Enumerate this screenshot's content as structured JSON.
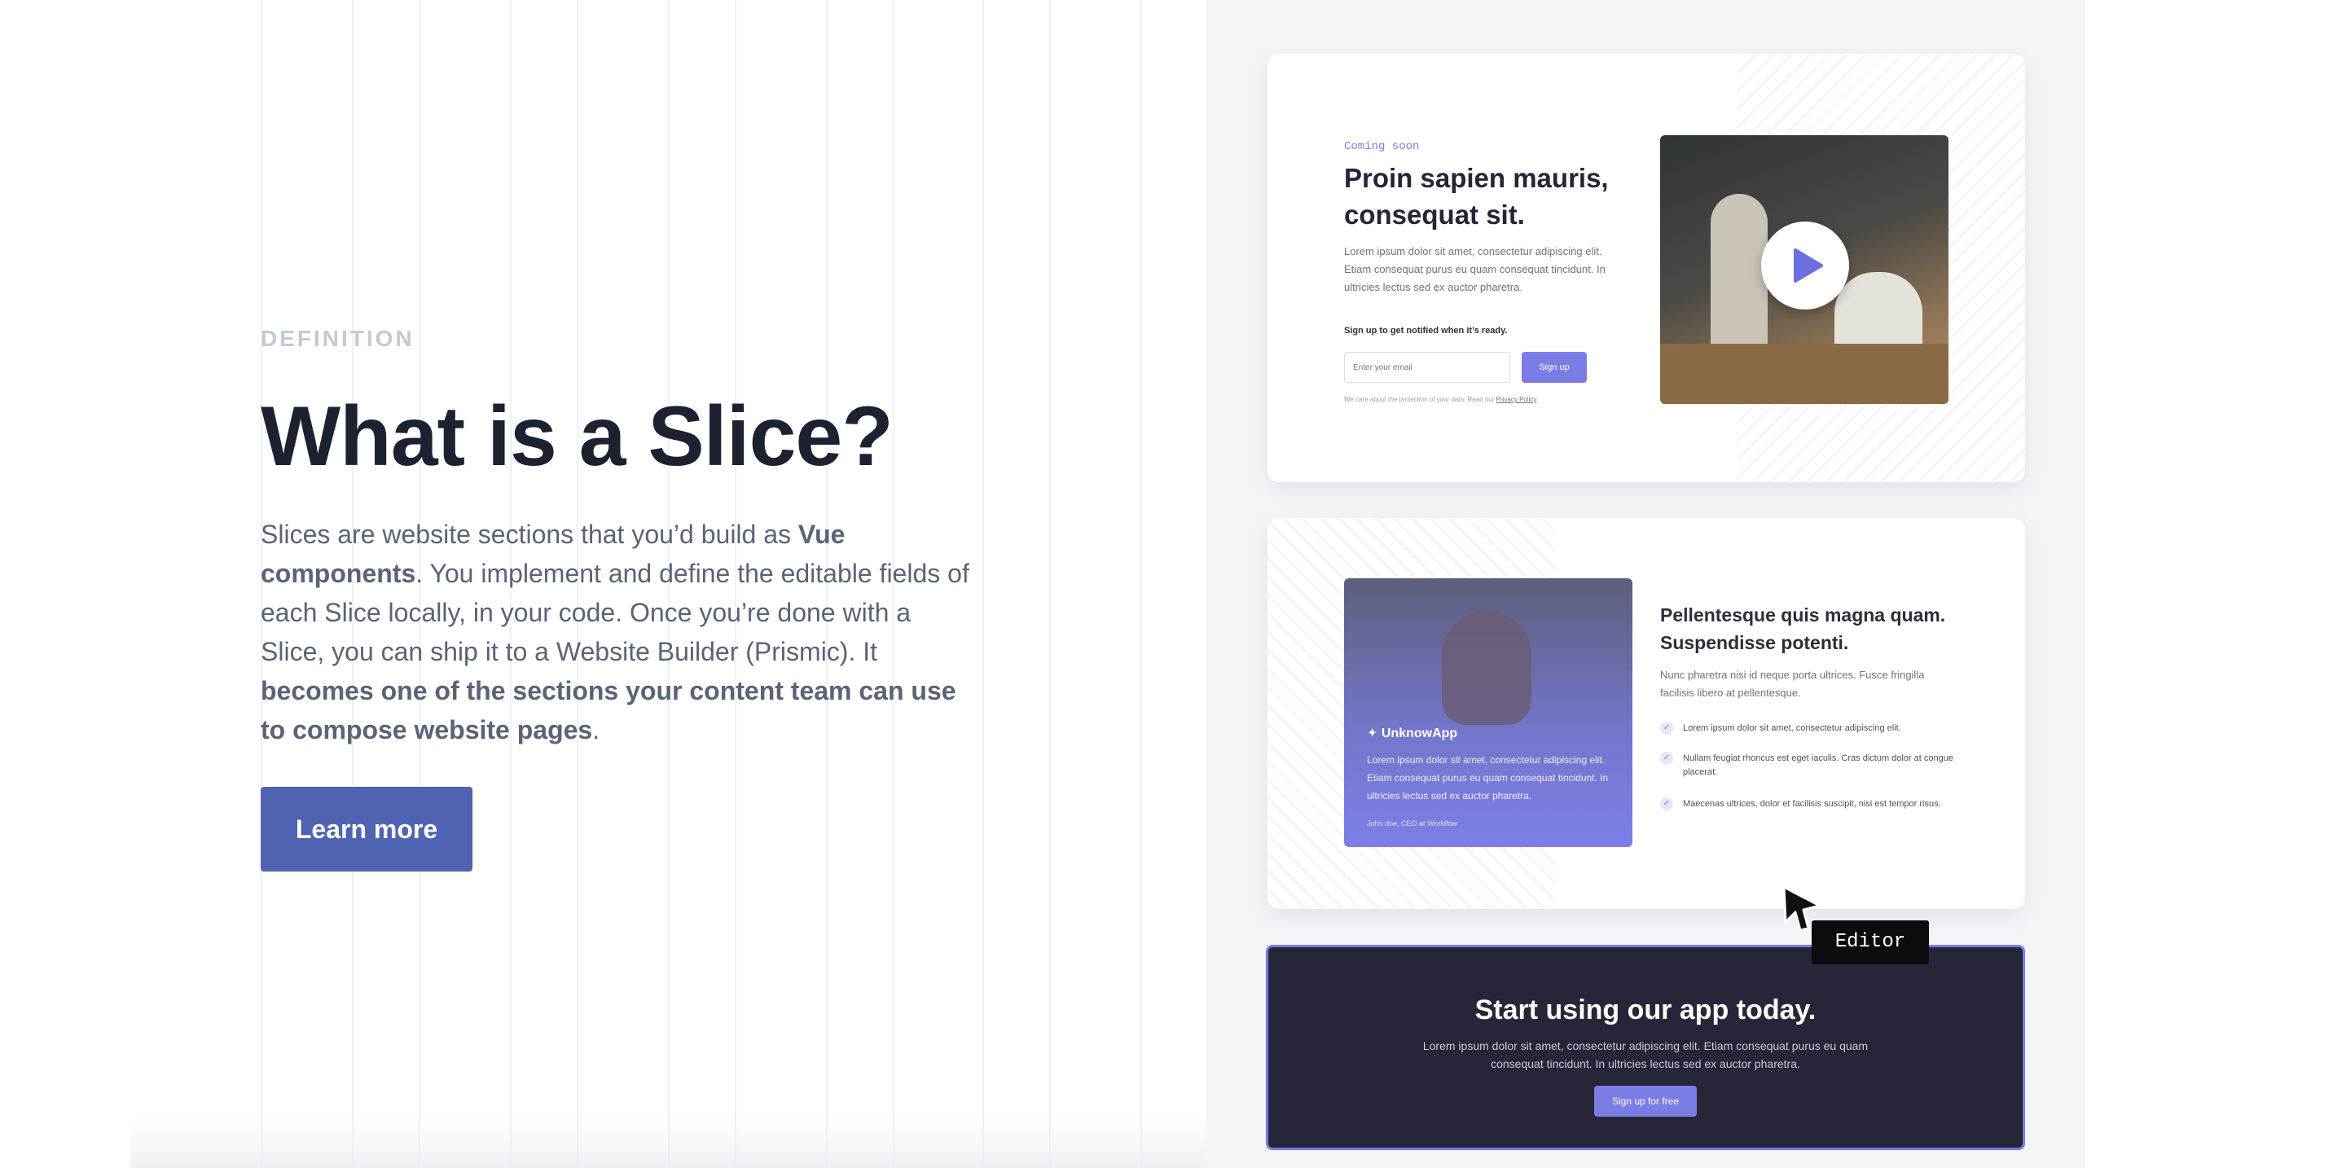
{
  "definition": {
    "eyebrow": "DEFINITION",
    "heading": "What is a Slice?",
    "para": {
      "t1": "Slices are website sections that you’d build as ",
      "b1": "Vue components",
      "t2": ". You implement and define the editable fields of each Slice locally, in your code. Once you’re done with a Slice, you can ship it to a Website Builder (Prismic). It ",
      "b2": "becomes one of the sections your content team can use to compose website pages",
      "t3": "."
    },
    "cta": "Learn more"
  },
  "card1": {
    "eyebrow": "Coming soon",
    "title": "Proin sapien mauris, consequat sit.",
    "body": "Lorem ipsum dolor sit amet, consectetur adipiscing elit. Etiam consequat purus eu quam consequat tincidunt. In ultricies lectus sed ex auctor pharetra.",
    "note": "Sign up to get notified when it’s ready.",
    "input_placeholder": "Enter your email",
    "button": "Sign up",
    "privacy_text": "We care about the protection of your data. Read our ",
    "privacy_link": "Privacy Policy"
  },
  "card2": {
    "logo": "UnknowApp",
    "quote": "Lorem ipsum dolor sit amet, consectetur adipiscing elit. Etiam consequat purus eu quam consequat tincidunt. In ultricies lectus sed ex auctor pharetra.",
    "author": "John doe, CEO at Workflow",
    "title": "Pellentesque quis magna quam. Suspendisse potenti.",
    "body": "Nunc pharetra nisi id neque porta ultrices. Fusce fringilla facilisis libero at pellentesque.",
    "features": [
      "Lorem ipsum dolor sit amet, consectetur adipiscing elit.",
      "Nullam feugiat rhoncus est eget iaculis. Cras dictum dolor at congue placerat.",
      "Maecenas ultrices, dolor et facilisis suscipit, nisi est tempor risus."
    ]
  },
  "editor_tag": "Editor",
  "card3": {
    "title": "Start using our app today.",
    "body": "Lorem ipsum dolor sit amet, consectetur adipiscing elit. Etiam consequat purus eu quam consequat tincidunt. In ultricies lectus sed ex auctor pharetra.",
    "button": "Sign up for free"
  },
  "colors": {
    "primary_button": "#5062b2",
    "accent": "#7b7de4",
    "heading": "#1d2231",
    "body_text": "#5a6377",
    "dark_card": "#262638"
  }
}
